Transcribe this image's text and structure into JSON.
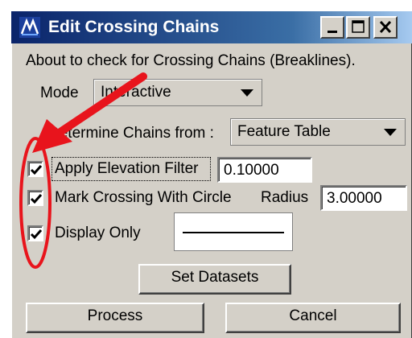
{
  "window": {
    "title": "Edit Crossing Chains",
    "controls": {
      "minimize": "minimize-icon",
      "maximize": "maximize-icon",
      "close": "close-icon"
    }
  },
  "description": "About to check for Crossing Chains (Breaklines).",
  "mode": {
    "label": "Mode",
    "value": "Interactive"
  },
  "determine": {
    "label": "Determine Chains from  :",
    "value": "Feature Table"
  },
  "elevation_filter": {
    "label": "Apply Elevation Filter",
    "checked": true,
    "value": "0.10000"
  },
  "mark_crossing": {
    "label": "Mark Crossing With Circle",
    "checked": true,
    "radius_label": "Radius",
    "radius_value": "3.00000"
  },
  "display_only": {
    "label": "Display Only",
    "checked": true
  },
  "buttons": {
    "set_datasets": "Set Datasets",
    "process": "Process",
    "cancel": "Cancel"
  },
  "annotation": {
    "color": "#e8141c"
  }
}
